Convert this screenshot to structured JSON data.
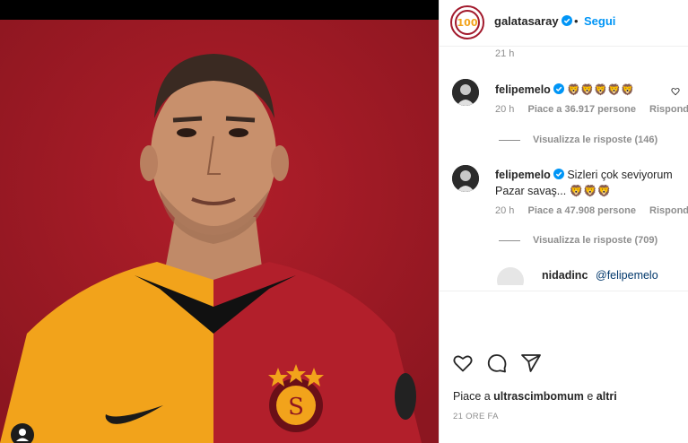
{
  "post": {
    "username": "galatasaray",
    "separator": "•",
    "follow_label": "Segui"
  },
  "comments": {
    "first_time": "21 h",
    "items": [
      {
        "username": "felipemelo",
        "text": "🦁🦁🦁🦁🦁",
        "time": "20 h",
        "likes": "Piace a 36.917 persone",
        "reply": "Rispondi",
        "view_replies": "Visualizza le risposte (146)"
      },
      {
        "username": "felipemelo",
        "text": "Sizleri çok seviyorum Pazar savaş... 🦁🦁🦁",
        "time": "20 h",
        "likes": "Piace a 47.908 persone",
        "reply": "Rispondi",
        "view_replies": "Visualizza le risposte (709)"
      }
    ],
    "reply_preview": {
      "username": "nidadinc",
      "mention": "@felipemelo"
    }
  },
  "footer": {
    "likes_prefix": "Piace a ",
    "likes_user": "ultrascimbomum",
    "likes_mid": " e ",
    "likes_others": "altri",
    "timestamp": "21 ORE FA"
  },
  "colors": {
    "accent": "#0095f6",
    "jersey_red": "#a2192c",
    "jersey_yellow": "#f2a31b",
    "background_red": "#9e1a24"
  },
  "icons": {
    "like": "heart-icon",
    "comment": "comment-icon",
    "share": "share-icon",
    "verified": "verified-badge-icon",
    "user_tag": "user-tag-icon"
  }
}
